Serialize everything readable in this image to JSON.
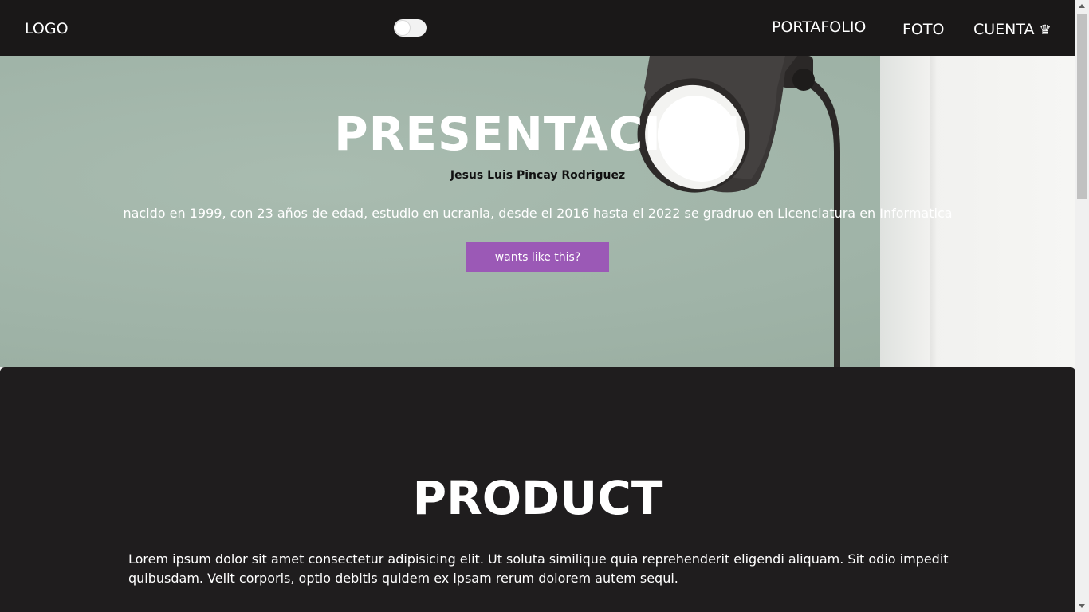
{
  "nav": {
    "logo": "LOGO",
    "links": [
      "PORTAFOLIO",
      "FOTO",
      "CUENTA"
    ],
    "account_icon": "crown-icon",
    "account_icon_glyph": "♛",
    "theme_toggle": "off"
  },
  "hero": {
    "title": "PRESENTACION",
    "subtitle": "Jesus Luis Pincay Rodriguez",
    "description": "nacido en 1999, con 23 años de edad, estudio en ucrania, desde el 2016 hasta el 2022 se gradruo en Licenciatura en Informatica",
    "button_label": "wants like this?",
    "button_color": "#9b59b6"
  },
  "product": {
    "title": "PRODUCT",
    "text": "Lorem ipsum dolor sit amet consectetur adipisicing elit. Ut soluta similique quia reprehenderit eligendi aliquam. Sit odio impedit quibusdam. Velit corporis, optio debitis quidem ex ipsam rerum dolorem autem sequi."
  },
  "colors": {
    "navbar_bg": "#1a1818",
    "section_bg": "#1f1d1e",
    "accent": "#9b59b6"
  }
}
